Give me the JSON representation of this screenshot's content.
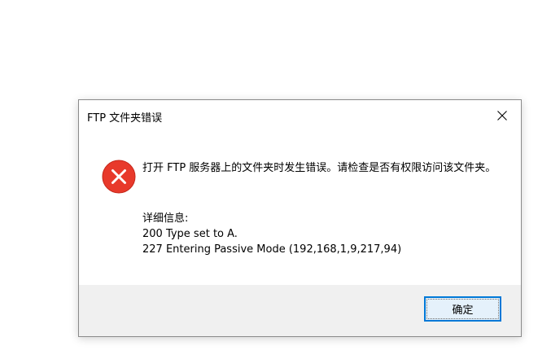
{
  "dialog": {
    "title": "FTP 文件夹错误",
    "icon": "error-circle-icon",
    "message": "打开 FTP 服务器上的文件夹时发生错误。请检查是否有权限访问该文件夹。",
    "details_label": "详细信息:",
    "details": [
      "200 Type set to A.",
      "227 Entering Passive Mode (192,168,1,9,217,94)"
    ],
    "ok_label": "确定"
  },
  "colors": {
    "error_red": "#e8392b",
    "button_border": "#0078d7",
    "button_bg": "#e5f1fb",
    "footer_bg": "#f0f0f0"
  }
}
